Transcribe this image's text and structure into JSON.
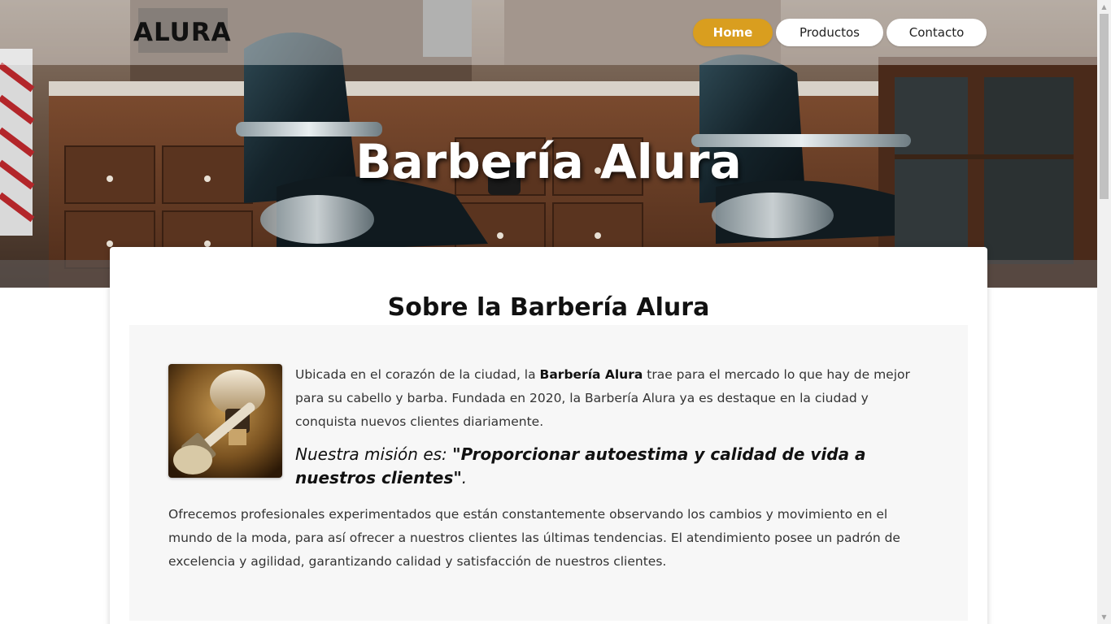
{
  "header": {
    "logo": "ALURA",
    "nav": [
      {
        "label": "Home",
        "active": true
      },
      {
        "label": "Productos",
        "active": false
      },
      {
        "label": "Contacto",
        "active": false
      }
    ]
  },
  "hero": {
    "title": "Barbería Alura",
    "image": "barbershop-interior-with-chairs"
  },
  "about": {
    "title": "Sobre la Barbería Alura",
    "image": "shaving-brush-and-razor",
    "intro_before": "Ubicada en el corazón de la ciudad, la ",
    "intro_bold": "Barbería Alura",
    "intro_after": " trae para el mercado lo que hay de mejor para su cabello y barba. Fundada en 2020, la Barbería Alura ya es destaque en la ciudad y conquista nuevos clientes diariamente.",
    "mission_prefix": "Nuestra misión es: ",
    "mission_quote": "\"Proporcionar autoestima y calidad de vida a nuestros clientes\"",
    "mission_suffix": ".",
    "services": "Ofrecemos profesionales experimentados que están constantemente observando los cambios y movimiento en el mundo de la moda, para así ofrecer a nuestros clientes las últimas tendencias. El atendimiento posee un padrón de excelencia y agilidad, garantizando calidad y satisfacción de nuestros clientes."
  },
  "colors": {
    "accent": "#d99e1f",
    "text": "#333333",
    "panel": "#f7f7f7"
  }
}
